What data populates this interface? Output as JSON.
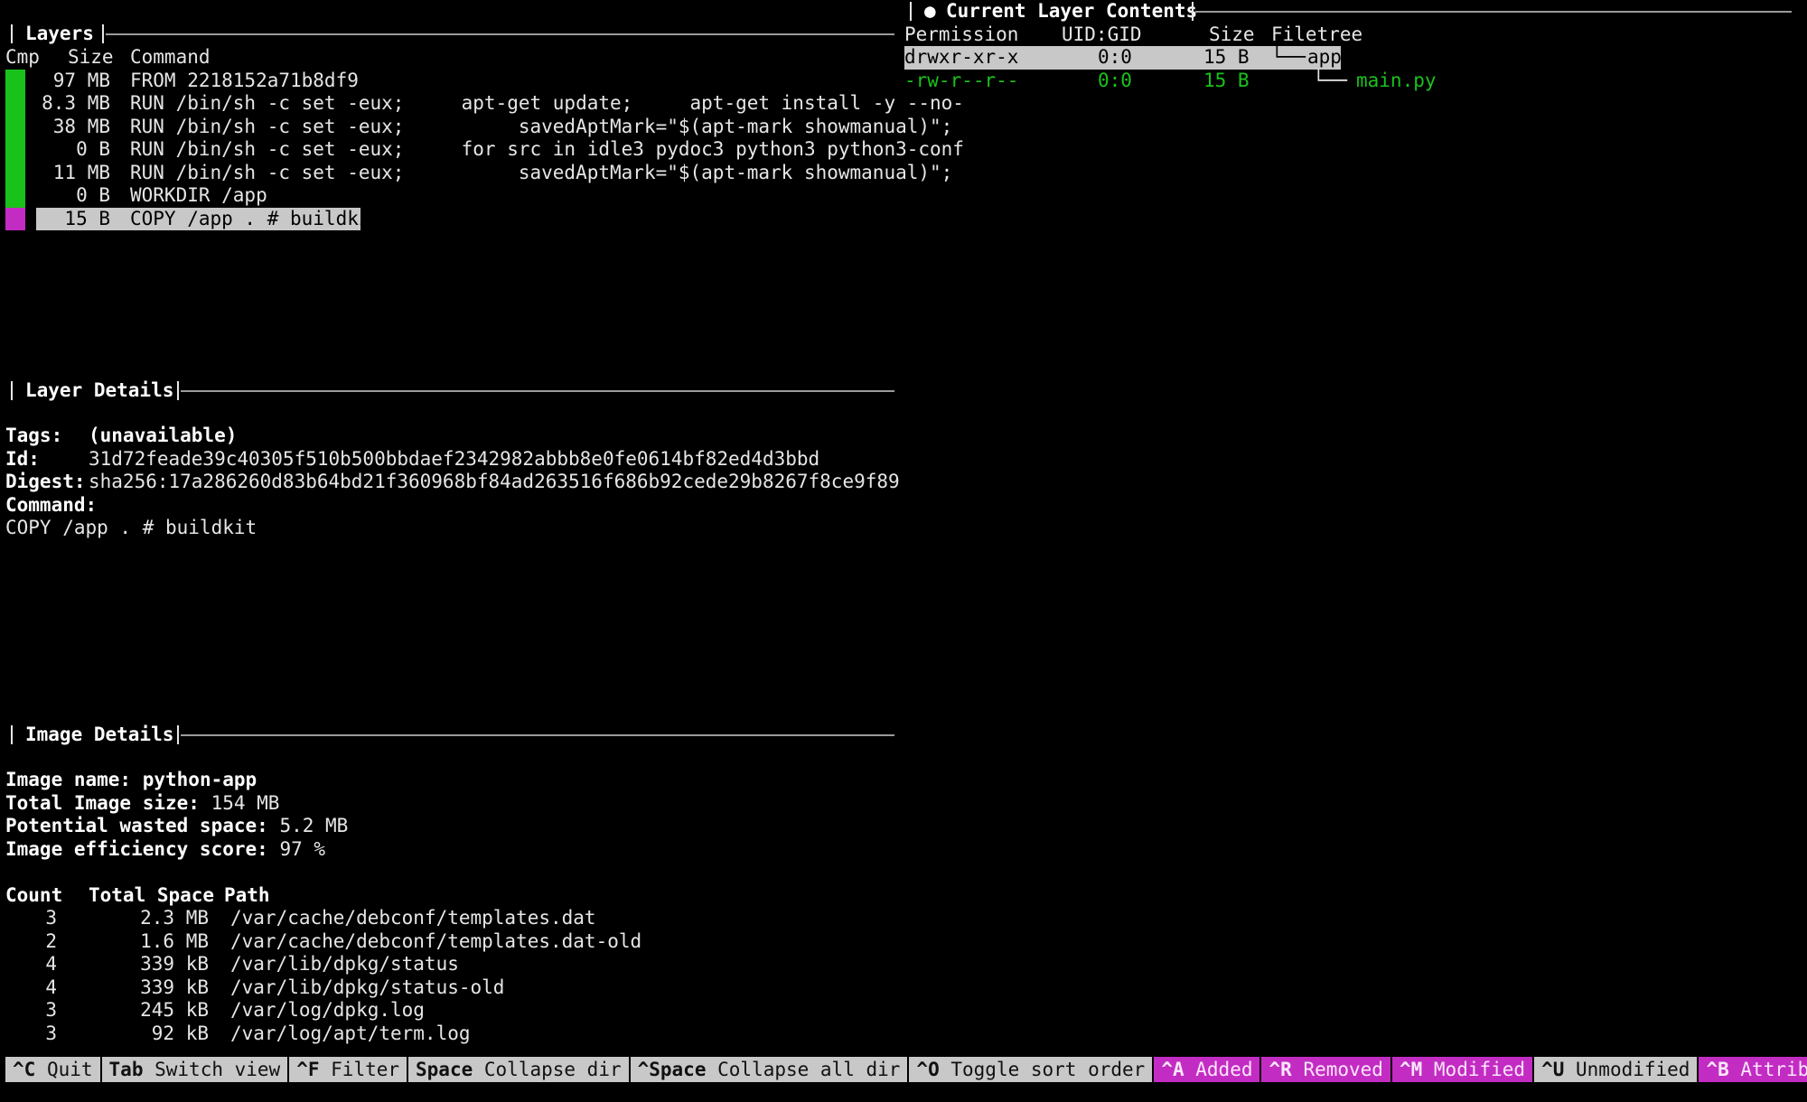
{
  "layers": {
    "title": "Layers",
    "col_cmp": "Cmp",
    "col_size": "Size",
    "col_command": "Command",
    "rows": [
      {
        "size": "97 MB",
        "command": "FROM 2218152a71b8df9",
        "color": "#19c21b"
      },
      {
        "size": "8.3 MB",
        "command": "RUN /bin/sh -c set -eux;     apt-get update;     apt-get install -y --no-",
        "color": "#19c21b"
      },
      {
        "size": "38 MB",
        "command": "RUN /bin/sh -c set -eux;          savedAptMark=\"$(apt-mark showmanual)\";",
        "color": "#19c21b"
      },
      {
        "size": "0 B",
        "command": "RUN /bin/sh -c set -eux;     for src in idle3 pydoc3 python3 python3-conf",
        "color": "#19c21b"
      },
      {
        "size": "11 MB",
        "command": "RUN /bin/sh -c set -eux;          savedAptMark=\"$(apt-mark showmanual)\";",
        "color": "#19c21b"
      },
      {
        "size": "0 B",
        "command": "WORKDIR /app",
        "color": "#19c21b"
      },
      {
        "size": "15 B",
        "command": "COPY /app . # buildkit",
        "color": "#c32cc3"
      }
    ]
  },
  "layer_details": {
    "title": "Layer Details",
    "tags_label": "Tags:",
    "tags_value": "(unavailable)",
    "id_label": "Id:",
    "id_value": "31d72feade39c40305f510b500bbdaef2342982abbb8e0fe0614bf82ed4d3bbd",
    "digest_label": "Digest:",
    "digest_value": "sha256:17a286260d83b64bd21f360968bf84ad263516f686b92cede29b8267f8ce9f89",
    "command_label": "Command:",
    "command_value": "COPY /app . # buildkit"
  },
  "image_details": {
    "title": "Image Details",
    "name_label": "Image name:",
    "name_value": "python-app",
    "size_label": "Total Image size:",
    "size_value": "154 MB",
    "wasted_label": "Potential wasted space:",
    "wasted_value": "5.2 MB",
    "eff_label": "Image efficiency score:",
    "eff_value": "97 %",
    "col_count": "Count",
    "col_total": "Total Space",
    "col_path": "Path",
    "rows": [
      {
        "count": "3",
        "space": "2.3 MB",
        "path": "/var/cache/debconf/templates.dat"
      },
      {
        "count": "2",
        "space": "1.6 MB",
        "path": "/var/cache/debconf/templates.dat-old"
      },
      {
        "count": "4",
        "space": "339 kB",
        "path": "/var/lib/dpkg/status"
      },
      {
        "count": "4",
        "space": "339 kB",
        "path": "/var/lib/dpkg/status-old"
      },
      {
        "count": "3",
        "space": "245 kB",
        "path": "/var/log/dpkg.log"
      },
      {
        "count": "3",
        "space": "92 kB",
        "path": "/var/log/apt/term.log"
      }
    ]
  },
  "contents": {
    "bullet": "●",
    "title": "Current Layer Contents",
    "col_perm": "Permission",
    "col_uid": "UID:GID",
    "col_size": "Size",
    "col_tree": "Filetree",
    "rows": [
      {
        "perm": "drwxr-xr-x",
        "uid": "0:0",
        "size": "15 B",
        "branch": "└──",
        "name": "app"
      },
      {
        "perm": "-rw-r--r--",
        "uid": "0:0",
        "size": "15 B",
        "branch": "└──",
        "name": "main.py"
      }
    ]
  },
  "footer": [
    {
      "key": "^C",
      "label": "Quit",
      "style": "gray"
    },
    {
      "key": "Tab",
      "label": "Switch view",
      "style": "gray"
    },
    {
      "key": "^F",
      "label": "Filter",
      "style": "gray"
    },
    {
      "key": "Space",
      "label": "Collapse dir",
      "style": "gray"
    },
    {
      "key": "^Space",
      "label": "Collapse all dir",
      "style": "gray"
    },
    {
      "key": "^O",
      "label": "Toggle sort order",
      "style": "gray"
    },
    {
      "key": "^A",
      "label": "Added",
      "style": "mag"
    },
    {
      "key": "^R",
      "label": "Removed",
      "style": "mag"
    },
    {
      "key": "^M",
      "label": "Modified",
      "style": "mag"
    },
    {
      "key": "^U",
      "label": "Unmodified",
      "style": "gray"
    },
    {
      "key": "^B",
      "label": "Attributes",
      "style": "mag"
    },
    {
      "key": "^",
      "label": "",
      "style": "gray"
    }
  ],
  "colors": {
    "added": "#19c21b",
    "modified": "#c32cc3",
    "selection": "#c8c8c8"
  }
}
